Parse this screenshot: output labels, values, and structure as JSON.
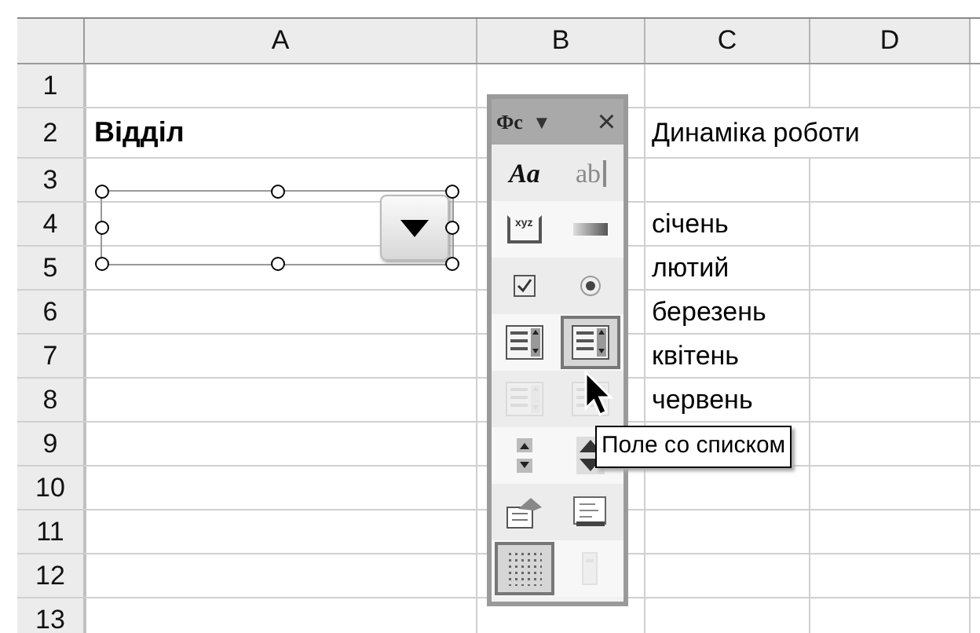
{
  "sheet": {
    "columns": [
      "A",
      "B",
      "C",
      "D"
    ],
    "rows": [
      {
        "number": "1"
      },
      {
        "number": "2",
        "column_a": "Відділ",
        "column_c": "Динаміка роботи"
      },
      {
        "number": "3"
      },
      {
        "number": "4",
        "column_c": "січень"
      },
      {
        "number": "5",
        "column_c": "лютий"
      },
      {
        "number": "6",
        "column_c": "березень"
      },
      {
        "number": "7",
        "column_c": "квітень"
      },
      {
        "number": "8",
        "column_c": "червень"
      },
      {
        "number": "9"
      },
      {
        "number": "10"
      },
      {
        "number": "11"
      },
      {
        "number": "12"
      },
      {
        "number": "13"
      }
    ]
  },
  "combo_box": {
    "selected": true
  },
  "toolbar": {
    "title": "Фс",
    "menu_glyph": "▼",
    "close_glyph": "×",
    "buttons": [
      {
        "kind": "label",
        "text": "Aa",
        "selected": false,
        "disabled": false
      },
      {
        "kind": "textbox",
        "text": "ab",
        "selected": false,
        "disabled": true
      },
      {
        "kind": "groupbox",
        "text": "xyz",
        "selected": false,
        "disabled": false
      },
      {
        "kind": "button",
        "selected": false,
        "disabled": false
      },
      {
        "kind": "checkbox",
        "selected": false,
        "disabled": false
      },
      {
        "kind": "radio",
        "selected": false,
        "disabled": false
      },
      {
        "kind": "listbox",
        "selected": false,
        "disabled": false
      },
      {
        "kind": "combobox",
        "selected": true,
        "disabled": false
      },
      {
        "kind": "listbox",
        "selected": false,
        "disabled": true
      },
      {
        "kind": "combobox",
        "selected": false,
        "disabled": true
      },
      {
        "kind": "scrollbar",
        "selected": false,
        "disabled": false
      },
      {
        "kind": "spinner",
        "selected": false,
        "disabled": false
      },
      {
        "kind": "properties",
        "selected": false,
        "disabled": false
      },
      {
        "kind": "code",
        "selected": false,
        "disabled": false
      },
      {
        "kind": "grid",
        "selected": true,
        "disabled": false
      },
      {
        "kind": "run",
        "selected": false,
        "disabled": true
      }
    ]
  },
  "tooltip": {
    "text": "Поле со списком"
  }
}
